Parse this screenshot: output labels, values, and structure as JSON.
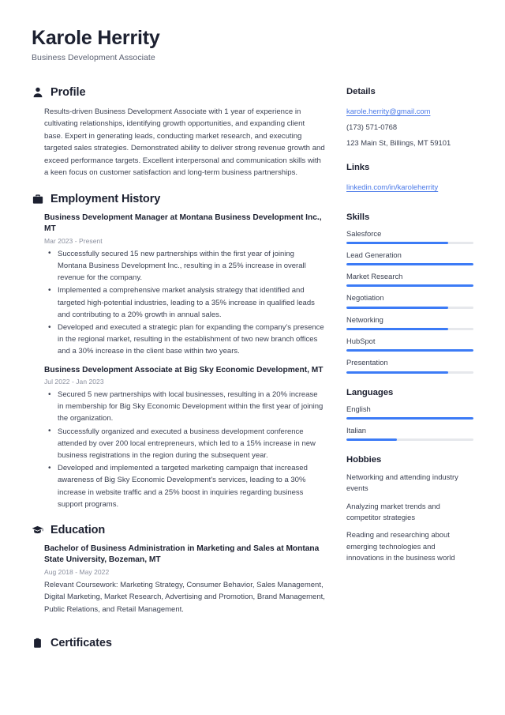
{
  "header": {
    "name": "Karole Herrity",
    "title": "Business Development Associate"
  },
  "accent_colors": {
    "link": "#4a79e8",
    "meter_fill": "#3c7bf6",
    "meter_track": "#e6e8ec",
    "heading": "#1c2030",
    "body": "#3b4152",
    "muted_date": "#8a8f9e"
  },
  "sections": {
    "profile": {
      "icon": "person-icon",
      "title": "Profile",
      "text": "Results-driven Business Development Associate with 1 year of experience in cultivating relationships, identifying growth opportunities, and expanding client base. Expert in generating leads, conducting market research, and executing targeted sales strategies. Demonstrated ability to deliver strong revenue growth and exceed performance targets. Excellent interpersonal and communication skills with a keen focus on customer satisfaction and long-term business partnerships."
    },
    "employment": {
      "icon": "briefcase-icon",
      "title": "Employment History",
      "entries": [
        {
          "title": "Business Development Manager at Montana Business Development Inc., MT",
          "date": "Mar 2023 - Present",
          "bullets": [
            "Successfully secured 15 new partnerships within the first year of joining Montana Business Development Inc., resulting in a 25% increase in overall revenue for the company.",
            "Implemented a comprehensive market analysis strategy that identified and targeted high-potential industries, leading to a 35% increase in qualified leads and contributing to a 20% growth in annual sales.",
            "Developed and executed a strategic plan for expanding the company's presence in the regional market, resulting in the establishment of two new branch offices and a 30% increase in the client base within two years."
          ]
        },
        {
          "title": "Business Development Associate at Big Sky Economic Development, MT",
          "date": "Jul 2022 - Jan 2023",
          "bullets": [
            "Secured 5 new partnerships with local businesses, resulting in a 20% increase in membership for Big Sky Economic Development within the first year of joining the organization.",
            "Successfully organized and executed a business development conference attended by over 200 local entrepreneurs, which led to a 15% increase in new business registrations in the region during the subsequent year.",
            "Developed and implemented a targeted marketing campaign that increased awareness of Big Sky Economic Development's services, leading to a 30% increase in website traffic and a 25% boost in inquiries regarding business support programs."
          ]
        }
      ]
    },
    "education": {
      "icon": "graduation-cap-icon",
      "title": "Education",
      "entries": [
        {
          "title": "Bachelor of Business Administration in Marketing and Sales at Montana State University, Bozeman, MT",
          "date": "Aug 2018 - May 2022",
          "note": "Relevant Coursework: Marketing Strategy, Consumer Behavior, Sales Management, Digital Marketing, Market Research, Advertising and Promotion, Brand Management, Public Relations, and Retail Management."
        }
      ]
    },
    "certificates": {
      "icon": "clipboard-icon",
      "title": "Certificates"
    }
  },
  "sidebar": {
    "details": {
      "title": "Details",
      "email": "karole.herrity@gmail.com",
      "phone": "(173) 571-0768",
      "address": "123 Main St, Billings, MT 59101"
    },
    "links": {
      "title": "Links",
      "items": [
        {
          "label": "linkedin.com/in/karoleherrity"
        }
      ]
    },
    "skills": {
      "title": "Skills",
      "items": [
        {
          "label": "Salesforce",
          "level": 80
        },
        {
          "label": "Lead Generation",
          "level": 100
        },
        {
          "label": "Market Research",
          "level": 100
        },
        {
          "label": "Negotiation",
          "level": 80
        },
        {
          "label": "Networking",
          "level": 80
        },
        {
          "label": "HubSpot",
          "level": 100
        },
        {
          "label": "Presentation",
          "level": 80
        }
      ]
    },
    "languages": {
      "title": "Languages",
      "items": [
        {
          "label": "English",
          "level": 100
        },
        {
          "label": "Italian",
          "level": 40
        }
      ]
    },
    "hobbies": {
      "title": "Hobbies",
      "items": [
        "Networking and attending industry events",
        "Analyzing market trends and competitor strategies",
        "Reading and researching about emerging technologies and innovations in the business world"
      ]
    }
  }
}
